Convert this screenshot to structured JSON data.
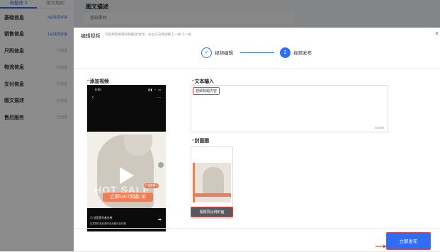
{
  "bg": {
    "tabs": [
      "待整改 0",
      "填写规则"
    ],
    "nav": [
      {
        "label": "基础信息",
        "status": "5必填项未填"
      },
      {
        "label": "销售信息",
        "status": "1必填项未填"
      },
      {
        "label": "尺码信息",
        "status": "已完成"
      },
      {
        "label": "物流信息",
        "status": "已完成"
      },
      {
        "label": "支付信息",
        "status": "已完成"
      },
      {
        "label": "图文描述",
        "status": "已完成"
      },
      {
        "label": "售后服务",
        "status": "已完成"
      }
    ],
    "section_title": "图文描述",
    "section_sub": "基础素材"
  },
  "modal": {
    "title": "编辑视频",
    "hint": "可使用空格键控制播放/暂停，左右方向键调整上一帧/下一帧",
    "close": "×",
    "steps": [
      {
        "num": "✓",
        "label": "视频编辑"
      },
      {
        "num": "2",
        "label": "视频发布"
      }
    ],
    "video_label": "添加视频",
    "text_label": "文本输入",
    "text_value": "视频标题内容",
    "counter": "6/1000",
    "cover_label": "封面图",
    "cover_button": "视频同比例封面",
    "publish": "立即发布"
  },
  "phone": {
    "time": "9:00",
    "status": "▮▮ ◔ ▭",
    "back": "‹",
    "more": "···",
    "bg_text": "HOT SALE",
    "promo": "立即GET同款 ▣",
    "tag": "广告推荐 ▸",
    "shop": "◎ 这里是作者名称",
    "title_line": "这里是作品标题作品标题作品标题",
    "share": "➦"
  },
  "colors": {
    "accent": "#2f6df6",
    "highlight": "#e3443a",
    "promo": "#ef7d55"
  }
}
